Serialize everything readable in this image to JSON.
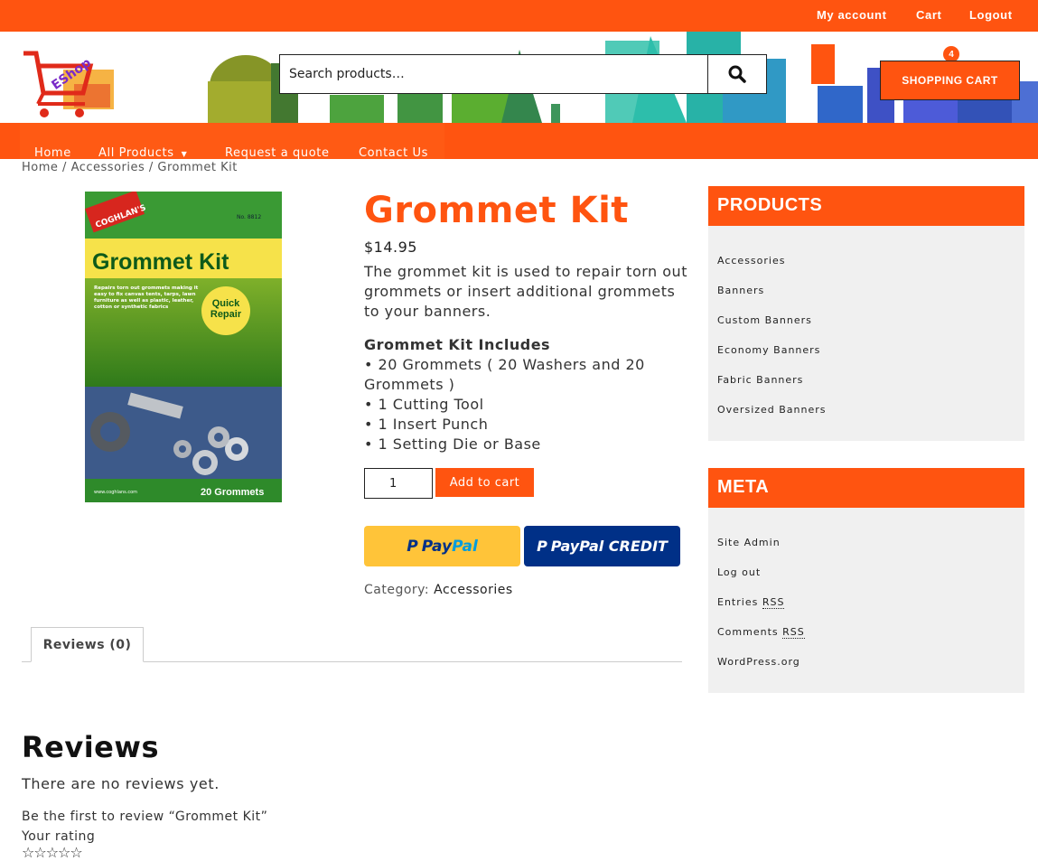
{
  "top_nav": {
    "my_account": "My account",
    "cart": "Cart",
    "logout": "Logout"
  },
  "logo": {
    "text": "EShop",
    "icon": "shopping-cart-logo"
  },
  "search": {
    "placeholder": "Search products…",
    "icon": "search-icon"
  },
  "cart": {
    "label": "SHOPPING CART",
    "count": "4"
  },
  "main_nav": {
    "items": [
      "Home",
      "All Products",
      "Request a quote",
      "Contact Us"
    ]
  },
  "breadcrumb": {
    "home": "Home",
    "sep": "/",
    "category": "Accessories",
    "current": "Grommet Kit"
  },
  "product": {
    "title": "Grommet Kit",
    "price": "$14.95",
    "description": "The grommet kit is used to repair torn out grommets or insert additional grommets to your banners.",
    "includes_heading": "Grommet Kit Includes",
    "includes": [
      "• 20 Grommets ( 20 Washers and 20 Grommets )",
      "• 1 Cutting Tool",
      "• 1 Insert Punch",
      "• 1 Setting Die or Base"
    ],
    "quantity": "1",
    "add_to_cart": "Add to cart",
    "paypal_label": "PayPal",
    "paypal_pay": "Pay",
    "paypal_pal": "Pal",
    "paypal_credit_label": "PayPal CREDIT",
    "category_label": "Category:",
    "category": "Accessories",
    "image": {
      "brand": "COGHLAN'S",
      "no": "No. 8812",
      "title": "Grommet Kit",
      "badge": "Quick Repair",
      "blurb": "Repairs torn out grommets making it easy to fix canvas tents, tarps, lawn furniture as well as plastic, leather, cotton or synthetic fabrics",
      "footer_url": "www.coghlans.com",
      "footer_count": "20 Grommets"
    }
  },
  "tabs": {
    "reviews": "Reviews (0)"
  },
  "reviews": {
    "heading": "Reviews",
    "none": "There are no reviews yet.",
    "first": "Be the first to review “Grommet Kit”",
    "rating_label": "Your rating",
    "stars": "☆☆☆☆☆"
  },
  "sidebar": {
    "products": {
      "title": "PRODUCTS",
      "items": [
        "Accessories",
        "Banners",
        "Custom Banners",
        "Economy Banners",
        "Fabric Banners",
        "Oversized Banners"
      ]
    },
    "meta": {
      "title": "META",
      "site_admin": "Site Admin",
      "log_out": "Log out",
      "entries": "Entries",
      "comments": "Comments",
      "rss": "RSS",
      "wordpress": "WordPress.org"
    }
  },
  "colors": {
    "accent": "#ff5410",
    "paypal_yellow": "#ffc439",
    "paypal_blue": "#003087",
    "sidebar_bg": "#f0f0f0"
  }
}
